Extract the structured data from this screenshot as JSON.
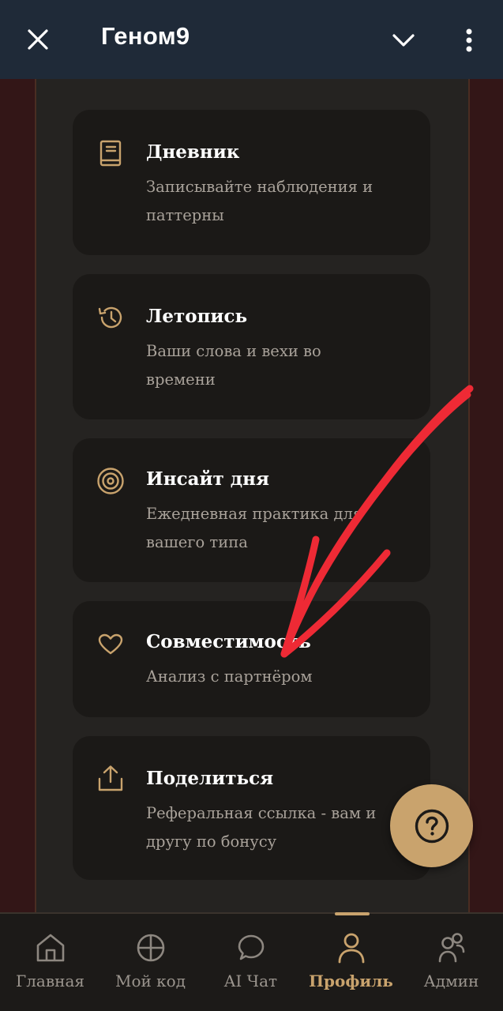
{
  "topbar": {
    "title": "Геном9"
  },
  "cards": [
    {
      "title": "Дневник",
      "desc_line1": "Записывайте наблюдения и",
      "desc_line2": "паттерны",
      "icon": "book-icon"
    },
    {
      "title": "Летопись",
      "desc_line1": "Ваши слова и вехи во",
      "desc_line2": "времени",
      "icon": "history-icon"
    },
    {
      "title": "Инсайт дня",
      "desc_line1": "Ежедневная практика для",
      "desc_line2": "вашего типа",
      "icon": "target-icon"
    },
    {
      "title": "Совместимость",
      "desc_line1": "Анализ с партнёром",
      "icon": "heart-icon"
    },
    {
      "title": "Поделиться",
      "desc_line1": "Реферальная ссылка - вам и",
      "desc_line2": "другу по бонусу",
      "icon": "share-icon"
    }
  ],
  "fab": {
    "icon": "help-icon"
  },
  "bottomnav": {
    "items": [
      {
        "label": "Главная",
        "icon": "home-icon"
      },
      {
        "label": "Мой код",
        "icon": "crosshair-icon"
      },
      {
        "label": "AI Чат",
        "icon": "chat-icon"
      },
      {
        "label": "Профиль",
        "icon": "user-icon"
      },
      {
        "label": "Админ",
        "icon": "users-icon"
      }
    ],
    "active_index": 3
  },
  "colors": {
    "accent": "#c9a36d",
    "topbar_bg": "#1f2a38",
    "card_bg": "#1b1917",
    "panel_bg": "#252321",
    "side_bg": "#331617",
    "annotation": "#ee2a35"
  }
}
